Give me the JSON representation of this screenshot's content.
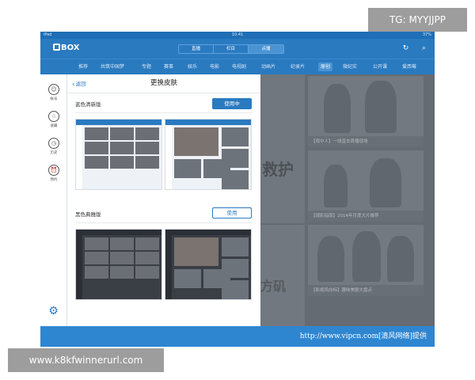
{
  "statusbar": {
    "device": "iPad",
    "time": "10:41",
    "battery": "37%"
  },
  "header": {
    "logo_text": "BOX",
    "segments": [
      "直播",
      "栏目",
      "点播"
    ],
    "active_segment": "点播",
    "icons": [
      "refresh-icon",
      "search-icon"
    ]
  },
  "category_nav": {
    "items": [
      "推荐",
      "共筑中国梦",
      "专题",
      "赛事",
      "娱乐",
      "电影",
      "电视剧",
      "动画片",
      "纪录片",
      "原创",
      "微纪实",
      "公开课",
      "爱西莓"
    ],
    "active": "原创"
  },
  "rail": {
    "items": [
      {
        "icon": "user-icon",
        "label": "帐号"
      },
      {
        "icon": "star-icon",
        "label": "收藏"
      },
      {
        "icon": "clock-icon",
        "label": "历史"
      },
      {
        "icon": "alarm-icon",
        "label": "预约"
      }
    ],
    "settings_icon": "gear-icon"
  },
  "skin_panel": {
    "back_label": "返回",
    "title": "更换皮肤",
    "skins": [
      {
        "name": "蓝色清新版",
        "button": "使用中",
        "active": true
      },
      {
        "name": "黑色典雅版",
        "button": "使用",
        "active": false
      }
    ]
  },
  "content": {
    "hero_text_1": "救护",
    "hero_text_2": "方矶",
    "cards": [
      {
        "caption": "【戏中人】一线直击首播现场"
      },
      {
        "caption": "【观影指南】2014年月度大片推荐"
      },
      {
        "caption": "【影视风向标】趣味美剧大盘点"
      }
    ]
  },
  "watermarks": {
    "strip": "http://www.vipcn.com[清风网络]提供",
    "tg": "TG: MYYJJPP",
    "url": "www.k8kfwinnerurl.com"
  },
  "colors": {
    "brand_blue": "#2a7ac0",
    "panel_bg": "#ffffff",
    "dim_overlay": "#787f8a"
  }
}
